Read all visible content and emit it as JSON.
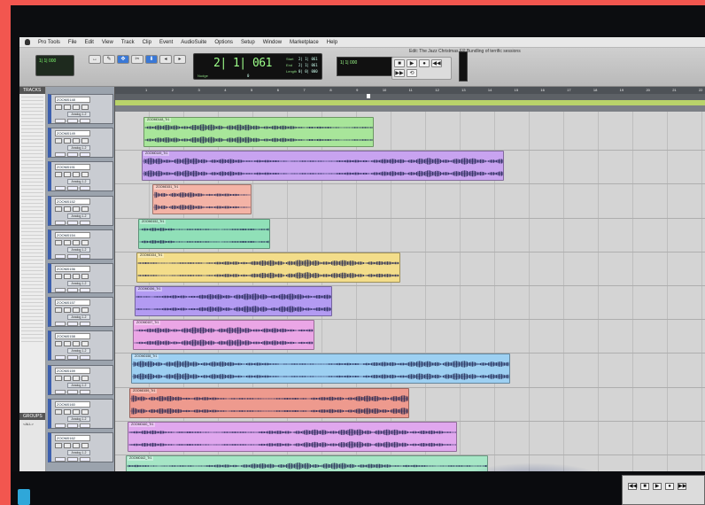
{
  "app": {
    "menu": [
      "Pro Tools",
      "File",
      "Edit",
      "View",
      "Track",
      "Clip",
      "Event",
      "AudioSuite",
      "Options",
      "Setup",
      "Window",
      "Marketplace",
      "Help"
    ],
    "window_title": "Edit: The Jazz Christmas EP Bundling of terrific sessions",
    "main_counter": "2| 1| 061",
    "counter_labels": {
      "start": "Start",
      "end": "End",
      "length": "Length"
    },
    "counter_values": {
      "start": "2| 1| 061",
      "end": "2| 1| 061",
      "length": "0| 0| 000"
    },
    "nudge_label": "Nudge",
    "cursor_value": "0",
    "sub_counter": "1| 1| 000",
    "tracks_panel_title": "TRACKS",
    "groups_panel_title": "GROUPS",
    "groups_item": "<ALL>"
  },
  "toolbar": {
    "tools": [
      "↔",
      "✎",
      "✥",
      "✂",
      "⬇",
      "◂",
      "▸"
    ],
    "transport": [
      "■",
      "▶",
      "●",
      "◀◀",
      "▶▶",
      "⟲"
    ]
  },
  "ruler": {
    "bars": [
      "1",
      "2",
      "3",
      "4",
      "5",
      "6",
      "7",
      "8",
      "9",
      "10",
      "11",
      "12",
      "13",
      "14",
      "15",
      "16",
      "17",
      "18",
      "19",
      "20",
      "21",
      "22",
      "23"
    ],
    "labels": [
      "Bars|Beats",
      "Min:Secs",
      "Tempo",
      "Markers"
    ]
  },
  "tracks": [
    {
      "name": "ZOOM0148",
      "io": "Analog 1-2",
      "color": "#a8e69a",
      "clip": "ZOOM0148_Tr1"
    },
    {
      "name": "ZOOM0149",
      "io": "Analog 1-2",
      "color": "#c8a3f0",
      "clip": "ZOOM0149_Tr1"
    },
    {
      "name": "ZOOM0151",
      "io": "Analog 1-2",
      "color": "#f4b3a6",
      "clip": "ZOOM0151_Tr1"
    },
    {
      "name": "ZOOM0152",
      "io": "Analog 1-2",
      "color": "#90e0b8",
      "clip": "ZOOM0152_Tr1"
    },
    {
      "name": "ZOOM0154",
      "io": "Analog 1-2",
      "color": "#f3dd8a",
      "clip": "ZOOM0154_Tr1"
    },
    {
      "name": "ZOOM0156",
      "io": "Analog 1-2",
      "color": "#b39bf2",
      "clip": "ZOOM0156_Tr1"
    },
    {
      "name": "ZOOM0157",
      "io": "Analog 1-2",
      "color": "#eba6e6",
      "clip": "ZOOM0157_Tr1"
    },
    {
      "name": "ZOOM0158",
      "io": "Analog 1-2",
      "color": "#9dd0f2",
      "clip": "ZOOM0158_Tr1"
    },
    {
      "name": "ZOOM0159",
      "io": "Analog 1-2",
      "color": "#ee9a8e",
      "clip": "ZOOM0159_Tr1"
    },
    {
      "name": "ZOOM0160",
      "io": "Analog 1-2",
      "color": "#e0a7ee",
      "clip": "ZOOM0160_Tr1"
    },
    {
      "name": "ZOOM0162",
      "io": "Analog 1-2",
      "color": "#a6e6c6",
      "clip": "ZOOM0162_Tr1"
    }
  ],
  "clip_lengths_bars": [
    7.0,
    11.0,
    3.0,
    4.0,
    8.0,
    6.0,
    5.5,
    11.5,
    8.5,
    10.0,
    11.0
  ]
}
